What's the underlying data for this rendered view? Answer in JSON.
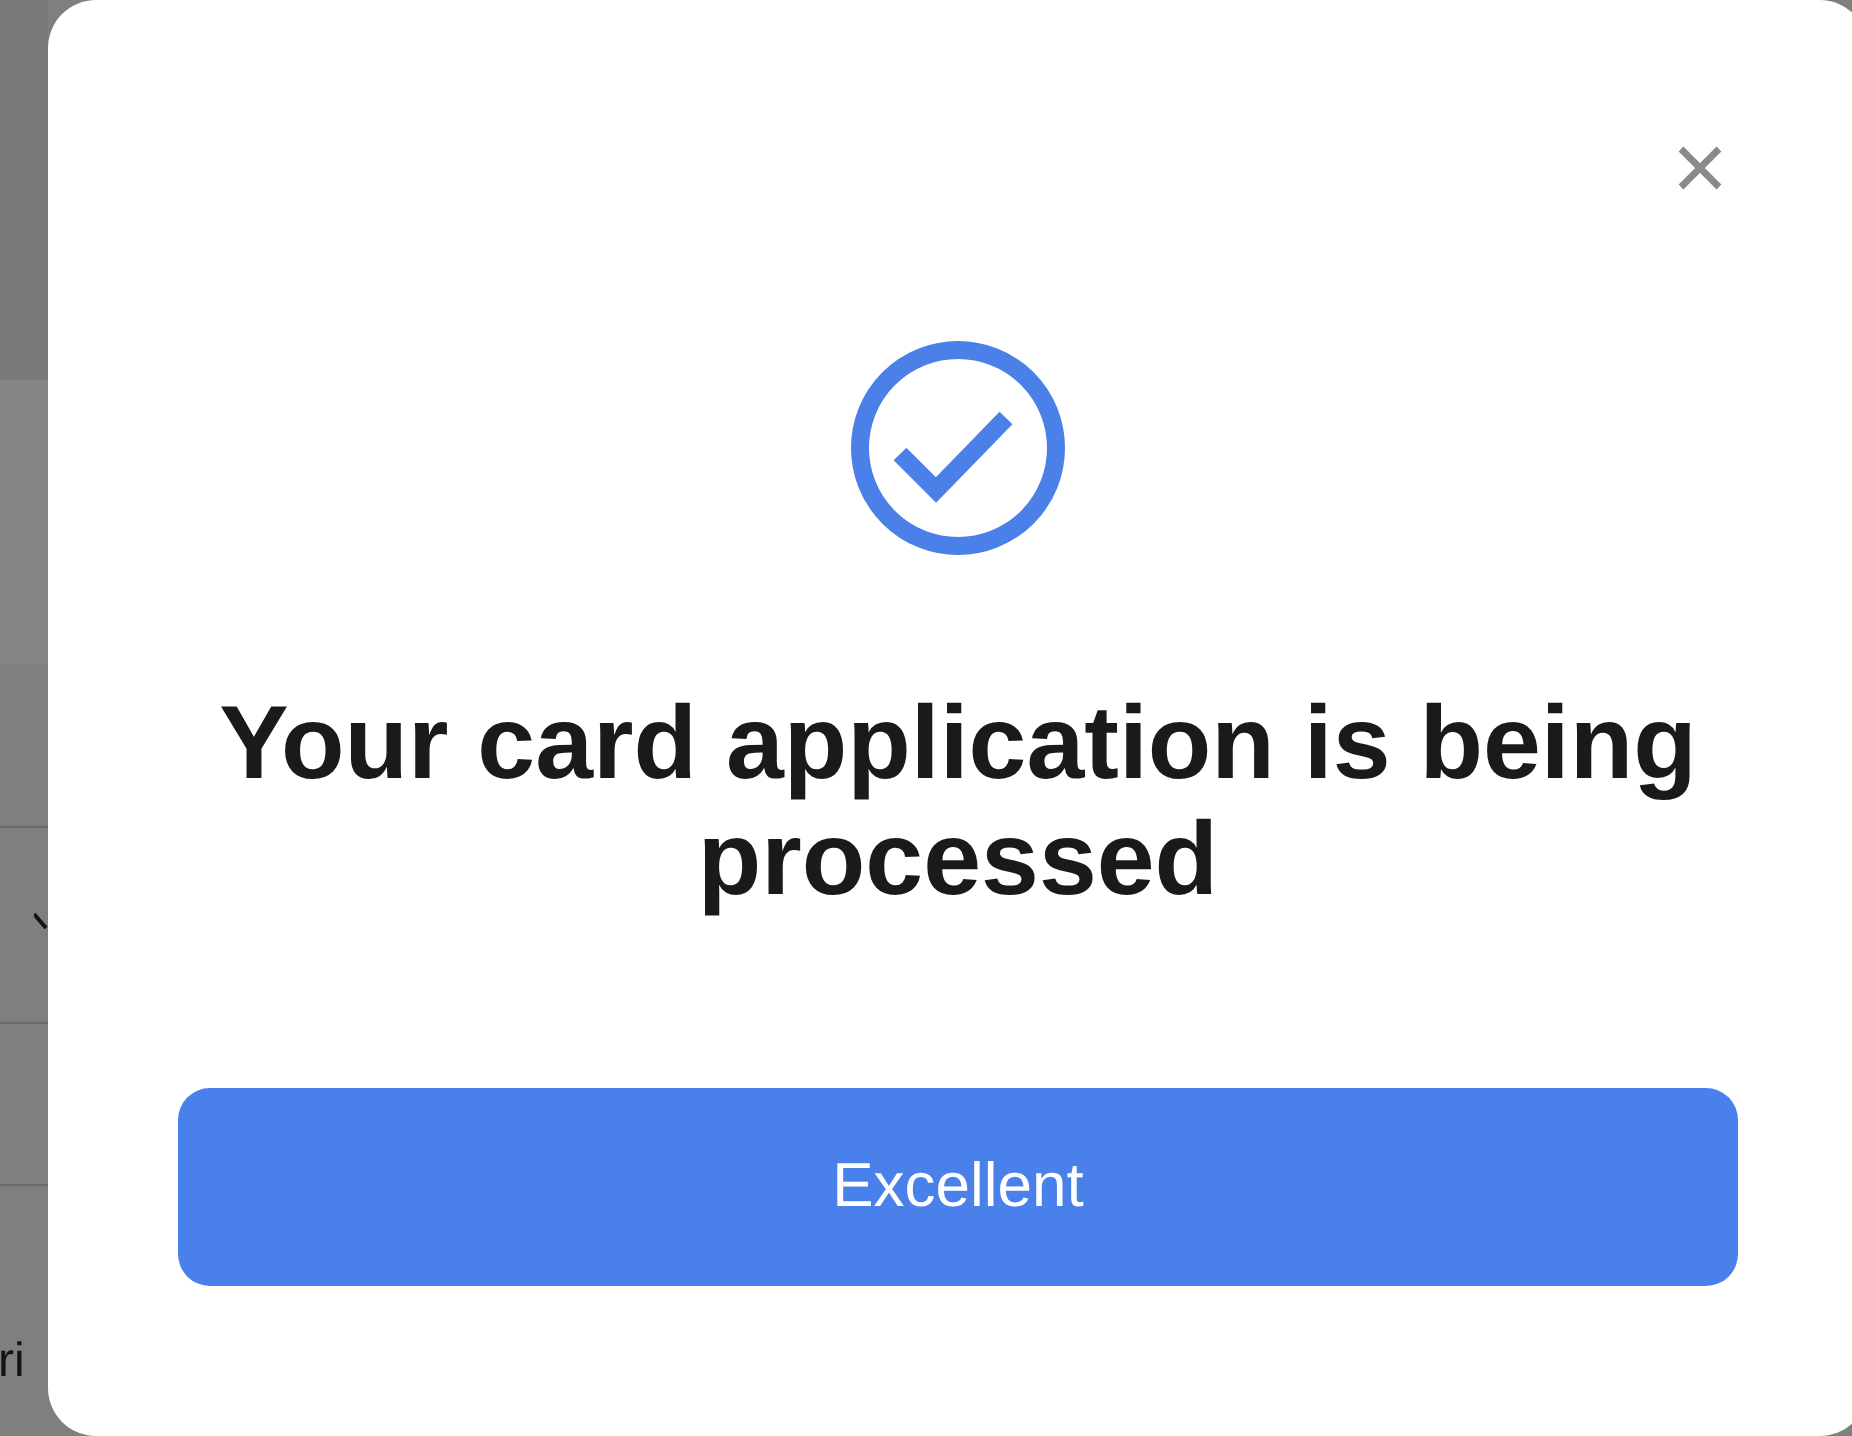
{
  "backdrop": {
    "partial_text": "ri"
  },
  "dialog": {
    "title": "Your card application is being processed",
    "button": "Excellent"
  }
}
